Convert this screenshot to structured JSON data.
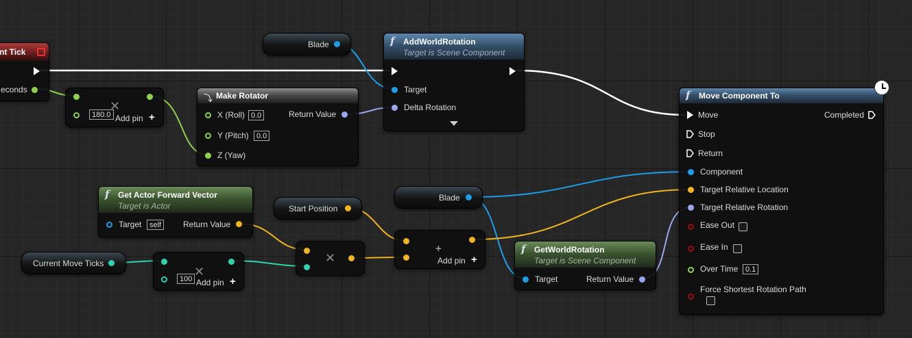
{
  "colors": {
    "exec": "#ffffff",
    "object": "#1e9ee8",
    "vector": "#f0b51e",
    "rotator": "#9ca6ee",
    "float": "#8ed24a",
    "bool": "#a00c0c",
    "int": "#2ed4b0"
  },
  "event_tick": {
    "title": "nt Tick",
    "seconds_label": "econds"
  },
  "mult_float": {
    "value": "180.0",
    "add_pin": "Add pin"
  },
  "make_rotator": {
    "title": "Make Rotator",
    "roll": "X (Roll)",
    "roll_value": "0.0",
    "pitch": "Y (Pitch)",
    "pitch_value": "0.0",
    "yaw": "Z (Yaw)",
    "return": "Return Value"
  },
  "blade_var_1": {
    "label": "Blade"
  },
  "add_world_rotation": {
    "title": "AddWorldRotation",
    "subtitle": "Target is Scene Component",
    "target": "Target",
    "delta": "Delta Rotation"
  },
  "move_component_to": {
    "title": "Move Component To",
    "move": "Move",
    "stop": "Stop",
    "ret": "Return",
    "completed": "Completed",
    "component": "Component",
    "target_loc": "Target Relative Location",
    "target_rot": "Target Relative Rotation",
    "ease_out": "Ease Out",
    "ease_in": "Ease In",
    "over_time": "Over Time",
    "over_time_value": "0.1",
    "force_shortest": "Force Shortest Rotation Path"
  },
  "get_actor_forward": {
    "title": "Get Actor Forward Vector",
    "subtitle": "Target is Actor",
    "target": "Target",
    "self": "self",
    "return": "Return Value"
  },
  "start_position": {
    "label": "Start Position"
  },
  "blade_var_2": {
    "label": "Blade"
  },
  "add_vector": {
    "add_pin": "Add pin"
  },
  "get_world_rotation": {
    "title": "GetWorldRotation",
    "subtitle": "Target is Scene Component",
    "target": "Target",
    "return": "Return Value"
  },
  "current_move_ticks": {
    "label": "Current Move Ticks"
  },
  "mult_int": {
    "value": "100",
    "add_pin": "Add pin"
  }
}
